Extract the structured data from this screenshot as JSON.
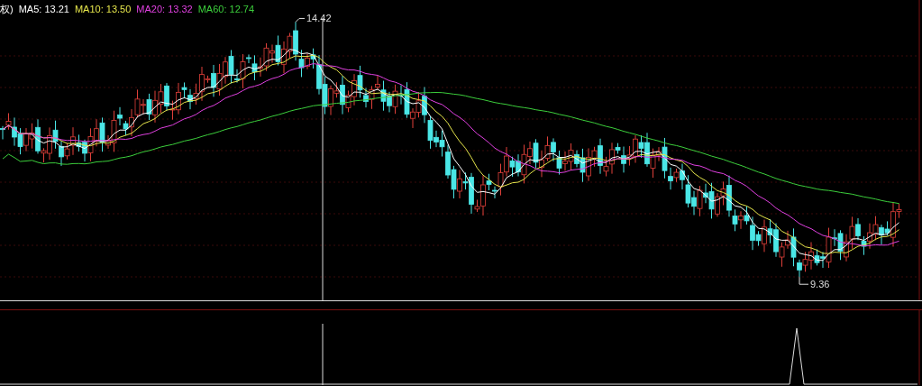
{
  "legend": {
    "prefix": "权)",
    "averages": [
      {
        "label": "MA5: 13.21",
        "color": "#ffffff"
      },
      {
        "label": "MA10: 13.50",
        "color": "#e6e64c"
      },
      {
        "label": "MA20: 13.32",
        "color": "#e040e0"
      },
      {
        "label": "MA60: 12.74",
        "color": "#3ccf3c"
      }
    ]
  },
  "price_chart": {
    "high_label": "14.42",
    "low_label": "9.36"
  }
}
